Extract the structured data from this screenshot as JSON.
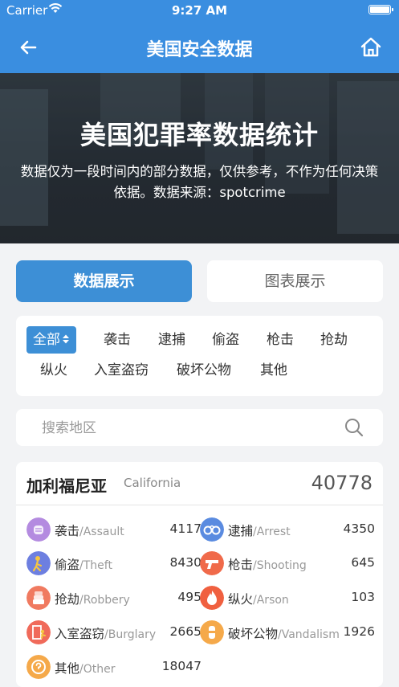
{
  "status_bar": {
    "carrier": "Carrier",
    "time": "9:27 AM"
  },
  "nav": {
    "title": "美国安全数据"
  },
  "hero": {
    "title": "美国犯罪率数据统计",
    "description_line1": "数据仅为一段时间内的部分数据，仅供参考，不作为任何决策",
    "description_line2": "依据。数据来源：spotcrime"
  },
  "tabs": [
    {
      "label": "数据展示",
      "active": true
    },
    {
      "label": "图表展示",
      "active": false
    }
  ],
  "filters": {
    "all": "全部",
    "items": [
      "袭击",
      "逮捕",
      "偷盗",
      "枪击",
      "抢劫",
      "纵火",
      "入室盗窃",
      "破坏公物",
      "其他"
    ]
  },
  "search": {
    "placeholder": "搜索地区",
    "value": ""
  },
  "card": {
    "name_cn": "加利福尼亚",
    "name_en": "California",
    "total": "40778",
    "stats": [
      {
        "cn": "袭击",
        "en": "/Assault",
        "value": "4117",
        "icon": "assault-icon",
        "color": "#b48be0"
      },
      {
        "cn": "逮捕",
        "en": "/Arrest",
        "value": "4350",
        "icon": "handcuffs-icon",
        "color": "#5a8be0"
      },
      {
        "cn": "偷盗",
        "en": "/Theft",
        "value": "8430",
        "icon": "thief-icon",
        "color": "#6d7fe0"
      },
      {
        "cn": "枪击",
        "en": "/Shooting",
        "value": "645",
        "icon": "gun-icon",
        "color": "#f06a4a"
      },
      {
        "cn": "抢劫",
        "en": "/Robbery",
        "value": "495",
        "icon": "robbery-icon",
        "color": "#f07a60"
      },
      {
        "cn": "纵火",
        "en": "/Arson",
        "value": "103",
        "icon": "fire-icon",
        "color": "#f06040"
      },
      {
        "cn": "入室盗窃",
        "en": "/Burglary",
        "value": "2665",
        "icon": "burglary-icon",
        "color": "#f06a5a"
      },
      {
        "cn": "破坏公物",
        "en": "/Vandalism",
        "value": "1926",
        "icon": "vandalism-icon",
        "color": "#f5a94a"
      },
      {
        "cn": "其他",
        "en": "/Other",
        "value": "18047",
        "icon": "other-icon",
        "color": "#f5a94a"
      }
    ]
  }
}
